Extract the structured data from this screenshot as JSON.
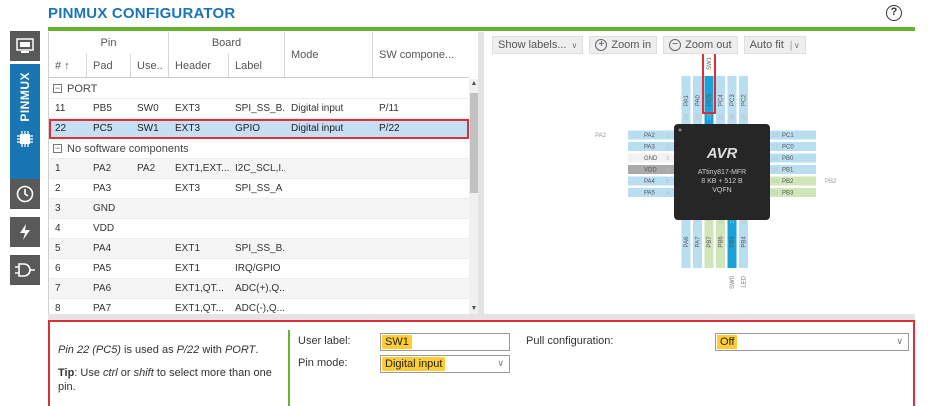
{
  "app": {
    "title": "PINMUX CONFIGURATOR",
    "help_icon": "?"
  },
  "nav": {
    "active_label": "PINMUX"
  },
  "table": {
    "header_groups": {
      "pin": "Pin",
      "board": "Board",
      "mode": "Mode",
      "sw": "SW compone..."
    },
    "columns": {
      "num": "# ↑",
      "pad": "Pad",
      "use": "Use..",
      "header": "Header",
      "label": "Label"
    },
    "groups": {
      "port": "PORT",
      "nosw": "No software components"
    },
    "port_rows": [
      {
        "num": "11",
        "pad": "PB5",
        "use": "SW0",
        "header": "EXT3",
        "label": "SPI_SS_B...",
        "mode": "Digital input",
        "sw": "P/11"
      },
      {
        "num": "22",
        "pad": "PC5",
        "use": "SW1",
        "header": "EXT3",
        "label": "GPIO",
        "mode": "Digital input",
        "sw": "P/22"
      }
    ],
    "nosw_rows": [
      {
        "num": "1",
        "pad": "PA2",
        "use": "PA2",
        "header": "EXT1,EXT...",
        "label": "I2C_SCL,I...",
        "mode": "",
        "sw": ""
      },
      {
        "num": "2",
        "pad": "PA3",
        "use": "",
        "header": "EXT3",
        "label": "SPI_SS_A",
        "mode": "",
        "sw": ""
      },
      {
        "num": "3",
        "pad": "GND",
        "use": "",
        "header": "",
        "label": "",
        "mode": "",
        "sw": ""
      },
      {
        "num": "4",
        "pad": "VDD",
        "use": "",
        "header": "",
        "label": "",
        "mode": "",
        "sw": ""
      },
      {
        "num": "5",
        "pad": "PA4",
        "use": "",
        "header": "EXT1",
        "label": "SPI_SS_B...",
        "mode": "",
        "sw": ""
      },
      {
        "num": "6",
        "pad": "PA5",
        "use": "",
        "header": "EXT1",
        "label": "IRQ/GPIO",
        "mode": "",
        "sw": ""
      },
      {
        "num": "7",
        "pad": "PA6",
        "use": "",
        "header": "EXT1,QT...",
        "label": "ADC(+),Q...",
        "mode": "",
        "sw": ""
      },
      {
        "num": "8",
        "pad": "PA7",
        "use": "",
        "header": "EXT1,QT...",
        "label": "ADC(-),Q...",
        "mode": "",
        "sw": ""
      }
    ]
  },
  "chip_view": {
    "toolbar": {
      "show_labels": "Show labels...",
      "zoom_in": "Zoom in",
      "zoom_out": "Zoom out",
      "auto_fit": "Auto fit"
    },
    "chip": {
      "brand": "AVR",
      "part": "ATtiny817-MFR",
      "memory": "8 KB + 512 B",
      "package": "VQFN"
    },
    "left_pins": [
      {
        "num": "1",
        "name": "PA2",
        "ext": "PA2",
        "color": "#b9def2"
      },
      {
        "num": "2",
        "name": "PA3",
        "ext": "",
        "color": "#b9def2"
      },
      {
        "num": "3",
        "name": "GND",
        "ext": "",
        "color": "#f2f2f2"
      },
      {
        "num": "4",
        "name": "VDD",
        "ext": "",
        "color": "#aaaaaa"
      },
      {
        "num": "5",
        "name": "PA4",
        "ext": "",
        "color": "#b9def2"
      },
      {
        "num": "6",
        "name": "PA5",
        "ext": "",
        "color": "#b9def2"
      }
    ],
    "right_pins": [
      {
        "num": "18",
        "name": "PC1",
        "ext": "",
        "color": "#b9def2"
      },
      {
        "num": "17",
        "name": "PC0",
        "ext": "",
        "color": "#b9def2"
      },
      {
        "num": "16",
        "name": "PB0",
        "ext": "",
        "color": "#b9def2"
      },
      {
        "num": "15",
        "name": "PB1",
        "ext": "",
        "color": "#b9def2"
      },
      {
        "num": "14",
        "name": "PB2",
        "ext": "PB2",
        "color": "#cfe6b8"
      },
      {
        "num": "13",
        "name": "PB3",
        "ext": "",
        "color": "#cfe6b8"
      }
    ],
    "top_pins": [
      {
        "num": "24",
        "name": "PA1",
        "color": "#b9def2"
      },
      {
        "num": "23",
        "name": "PA0",
        "color": "#b9def2"
      },
      {
        "num": "22",
        "name": "PC5",
        "color": "#1aa3d9"
      },
      {
        "num": "21",
        "name": "PC4",
        "color": "#b9def2"
      },
      {
        "num": "20",
        "name": "PC3",
        "color": "#b9def2"
      },
      {
        "num": "19",
        "name": "PC2",
        "color": "#b9def2"
      }
    ],
    "bottom_pins": [
      {
        "num": "7",
        "name": "PA6",
        "color": "#b9def2"
      },
      {
        "num": "8",
        "name": "PA7",
        "color": "#b9def2"
      },
      {
        "num": "9",
        "name": "PB7",
        "color": "#cfe6b8"
      },
      {
        "num": "10",
        "name": "PB6",
        "color": "#cfe6b8"
      },
      {
        "num": "11",
        "name": "PB5",
        "color": "#1aa3d9"
      },
      {
        "num": "12",
        "name": "PB4",
        "color": "#b9def2"
      }
    ],
    "top_ext": [
      "",
      "",
      "SW1",
      "",
      "",
      ""
    ],
    "bottom_ext": [
      "",
      "",
      "",
      "",
      "SW0",
      "LED"
    ]
  },
  "details": {
    "info_pin": "Pin 22 (PC5)",
    "info_mid": " is used as ",
    "info_sw": "P/22",
    "info_with": " with ",
    "info_comp": "PORT",
    "info_end": ".",
    "tip_label": "Tip",
    "tip_1": ": Use ",
    "tip_ctrl": "ctrl",
    "tip_or": " or ",
    "tip_shift": "shift",
    "tip_2": " to select more than one pin.",
    "user_label_label": "User label:",
    "user_label_value": "SW1",
    "pin_mode_label": "Pin mode:",
    "pin_mode_value": "Digital input",
    "pull_label": "Pull configuration:",
    "pull_value": "Off"
  },
  "colors": {
    "accent": "#1a76b3",
    "green": "#6ab42d",
    "highlight": "#d9303a",
    "field_fill": "#ffcc33",
    "chip_body": "#262626"
  }
}
